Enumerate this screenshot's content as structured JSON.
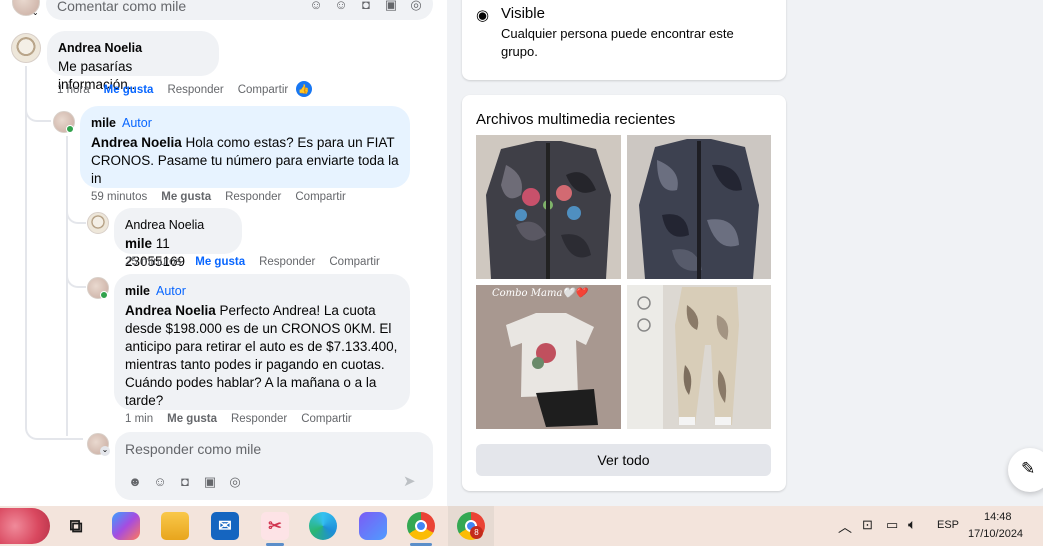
{
  "composer_top": {
    "placeholder": "Comentar como mile"
  },
  "comments": [
    {
      "author": "Andrea Noelia",
      "text": "Me pasarías información..",
      "time": "1 hora",
      "like": "Me gusta",
      "reply": "Responder",
      "share": "Compartir"
    },
    {
      "author": "mile",
      "badge": "Autor",
      "mention": "Andrea Noelia",
      "text": " Hola como estas? Es para un FIAT CRONOS. Pasame tu número para enviarte toda la in",
      "time": "59 minutos",
      "like": "Me gusta",
      "reply": "Responder",
      "share": "Compartir"
    },
    {
      "author": "Andrea Noelia",
      "mention": "mile",
      "text": " 11 23055169",
      "time": "25 minutos",
      "like": "Me gusta",
      "reply": "Responder",
      "share": "Compartir"
    },
    {
      "author": "mile",
      "badge": "Autor",
      "mention": "Andrea Noelia",
      "text": " Perfecto Andrea! La cuota desde $198.000 es de un CRONOS 0KM. El anticipo para retirar el auto es de $7.133.400, mientras tanto podes ir pagando en cuotas. Cuándo podes hablar? A la mañana o a la tarde?",
      "time": "1 min",
      "like": "Me gusta",
      "reply": "Responder",
      "share": "Compartir"
    }
  ],
  "reply_composer": {
    "placeholder": "Responder como mile"
  },
  "visibility": {
    "title": "Visible",
    "description": "Cualquier persona puede encontrar este grupo."
  },
  "media": {
    "title": "Archivos multimedia recientes",
    "overlay_text": "Combo Mama🤍❤️",
    "button": "Ver todo"
  },
  "taskbar": {
    "language": "ESP",
    "time": "14:48",
    "date": "17/10/2024",
    "chrome_badge": "8"
  },
  "colors": {
    "accent": "#0866ff",
    "secondary_text": "#65676b",
    "bubble_gray": "#f0f2f5",
    "bubble_blue": "#e7f3ff"
  }
}
